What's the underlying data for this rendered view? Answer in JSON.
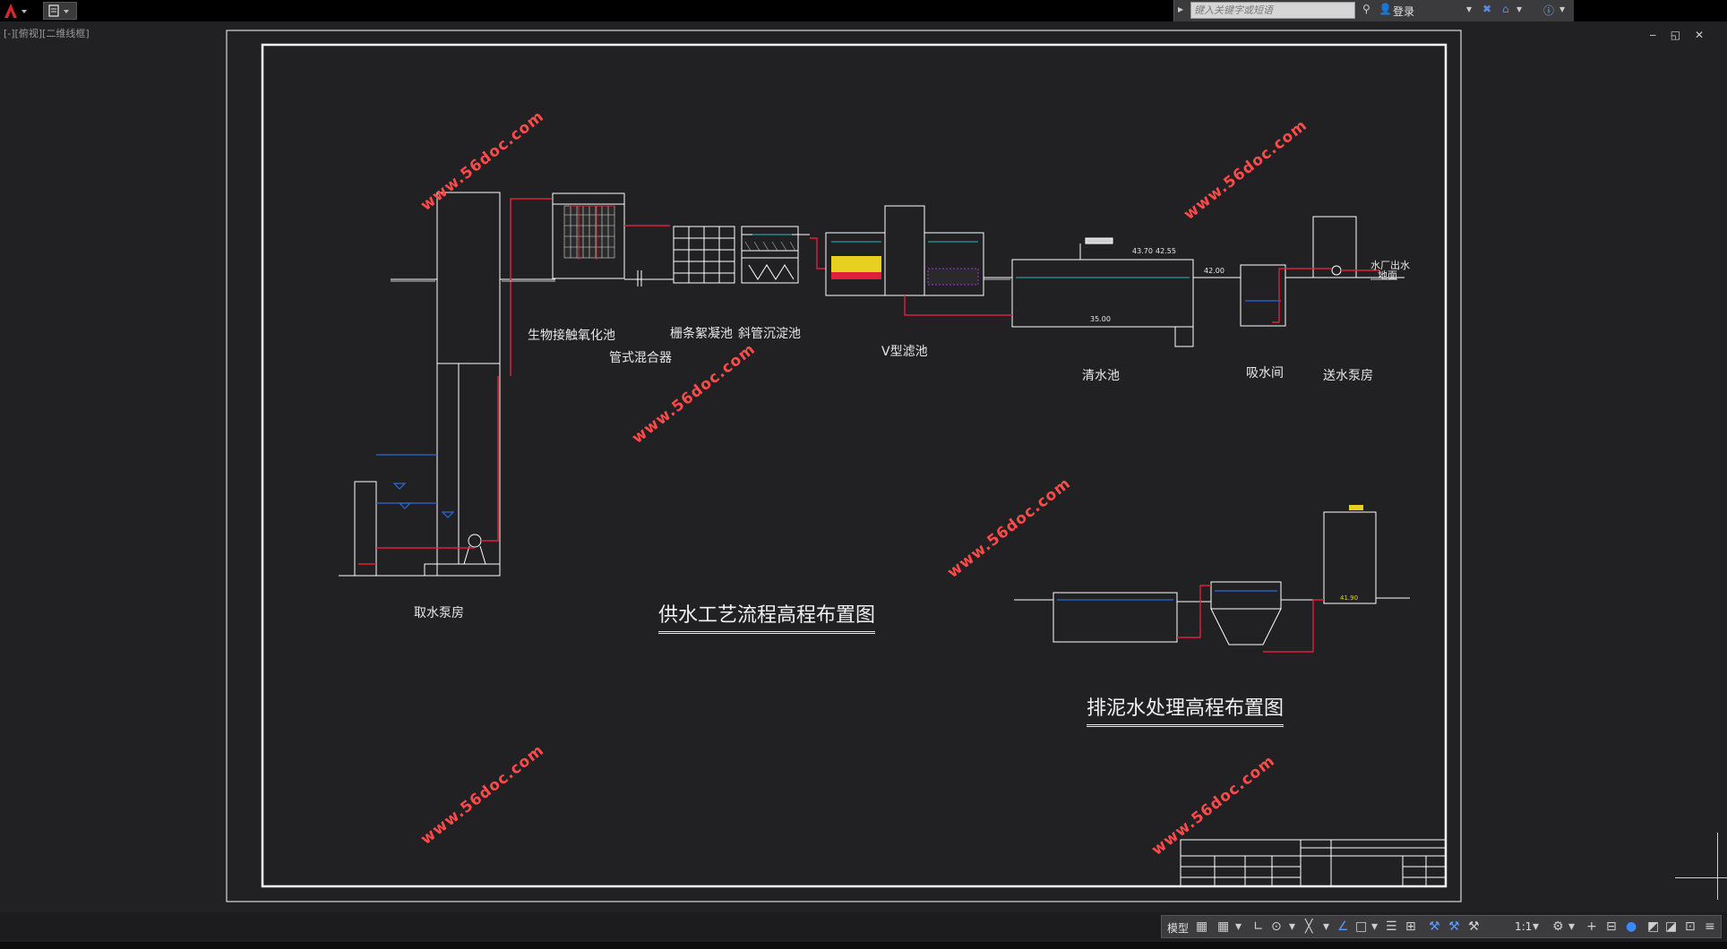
{
  "app": {
    "search_placeholder": "键入关键字或短语",
    "login_label": "登录",
    "viewport_label": "[-][俯视][二维线框]",
    "window_controls": "‒ ◱ ✕"
  },
  "drawing": {
    "labels": {
      "intake_pump": "取水泵房",
      "bio_oxidation": "生物接触氧化池",
      "grid_flocculation": "栅条絮凝池",
      "tube_settling": "斜管沉淀池",
      "tube_mixer": "管式混合器",
      "v_filter": "V型滤池",
      "clear_well": "清水池",
      "suction_well": "吸水间",
      "delivery_pump": "送水泵房",
      "plant_outlet": "水厂出水",
      "ground": "地面"
    },
    "title_main": "供水工艺流程高程布置图",
    "title_sludge": "排泥水处理高程布置图",
    "watermark": "www.56doc.com",
    "elevations": {
      "e1": "43.70",
      "e2": "42.55",
      "e3": "42.00",
      "e4": "35.00",
      "e5": "41.90"
    }
  },
  "status": {
    "model_label": "模型",
    "scale_label": "1:1"
  },
  "colors": {
    "background": "#212123",
    "frame": "#ffffff",
    "pipe_red": "#e0203a",
    "water_cyan": "#20c0c0",
    "water_blue": "#2a6ad8",
    "filter_yellow": "#e8d020",
    "watermark_red": "#ff4a4a"
  }
}
